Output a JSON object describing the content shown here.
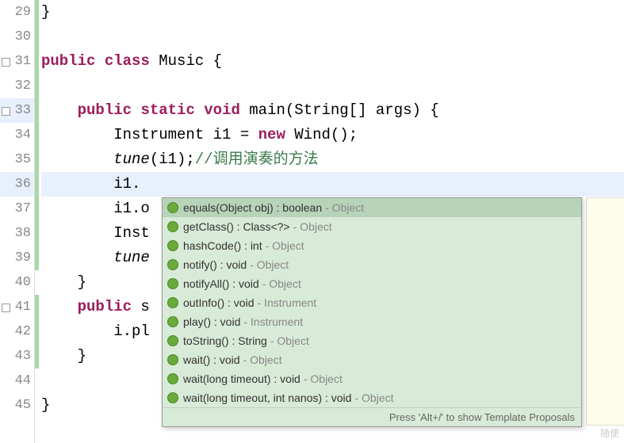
{
  "gutter": {
    "lines": [
      "29",
      "30",
      "31",
      "32",
      "33",
      "34",
      "35",
      "36",
      "37",
      "38",
      "39",
      "40",
      "41",
      "42",
      "43",
      "44",
      "45"
    ]
  },
  "code": {
    "l29": "}",
    "l30": "",
    "l31_kw1": "public",
    "l31_kw2": "class",
    "l31_cls": "Music",
    "l31_tail": " {",
    "l32": "",
    "l33_kw1": "public",
    "l33_kw2": "static",
    "l33_kw3": "void",
    "l33_main": "main(String[] args) {",
    "l34_pre": "        Instrument i1 = ",
    "l34_new": "new",
    "l34_tail": " Wind();",
    "l35_pre": "        ",
    "l35_call": "tune",
    "l35_args": "(i1);",
    "l35_cmt": "//调用演奏的方法",
    "l36": "        i1.",
    "l37": "        i1.o",
    "l38": "        Inst",
    "l39": "        ",
    "l39_call": "tune",
    "l40": "    }",
    "l41_pre": "    ",
    "l41_kw1": "public",
    "l41_tail": " s",
    "l42": "        i.pl",
    "l43": "    }",
    "l44": "",
    "l45": "}"
  },
  "autocomplete": {
    "items": [
      {
        "sig": "equals(Object obj) : boolean",
        "origin": "Object",
        "selected": true
      },
      {
        "sig": "getClass() : Class<?>",
        "origin": "Object",
        "selected": false
      },
      {
        "sig": "hashCode() : int",
        "origin": "Object",
        "selected": false
      },
      {
        "sig": "notify() : void",
        "origin": "Object",
        "selected": false
      },
      {
        "sig": "notifyAll() : void",
        "origin": "Object",
        "selected": false
      },
      {
        "sig": "outInfo() : void",
        "origin": "Instrument",
        "selected": false
      },
      {
        "sig": "play() : void",
        "origin": "Instrument",
        "selected": false
      },
      {
        "sig": "toString() : String",
        "origin": "Object",
        "selected": false
      },
      {
        "sig": "wait() : void",
        "origin": "Object",
        "selected": false
      },
      {
        "sig": "wait(long timeout) : void",
        "origin": "Object",
        "selected": false
      },
      {
        "sig": "wait(long timeout, int nanos) : void",
        "origin": "Object",
        "selected": false
      }
    ],
    "footer": "Press 'Alt+/' to show Template Proposals"
  },
  "watermark": "随便"
}
